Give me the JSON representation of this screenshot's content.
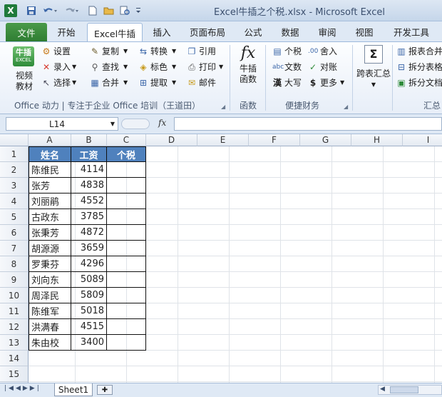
{
  "window": {
    "title": "Excel牛插之个税.xlsx - Microsoft Excel",
    "app_icon": "X"
  },
  "quick_access": {
    "save_icon": "save-icon",
    "undo_icon": "undo-icon",
    "redo_icon": "redo-icon",
    "new_icon": "new-file-icon",
    "open_icon": "open-folder-icon",
    "preview_icon": "print-preview-icon",
    "customize_icon": "customize-icon"
  },
  "tabs": [
    {
      "label": "文件"
    },
    {
      "label": "开始"
    },
    {
      "label": "Excel牛插"
    },
    {
      "label": "插入"
    },
    {
      "label": "页面布局"
    },
    {
      "label": "公式"
    },
    {
      "label": "数据"
    },
    {
      "label": "审阅"
    },
    {
      "label": "视图"
    },
    {
      "label": "开发工具"
    }
  ],
  "ribbon": {
    "logo": {
      "line1": "牛插",
      "line2": "EXCEL"
    },
    "video": {
      "line1": "视频",
      "line2": "教材"
    },
    "g1": {
      "settings": "设置",
      "enter": "录入",
      "select": "选择"
    },
    "g2": {
      "copy": "复制",
      "find": "查找",
      "merge": "合并"
    },
    "g3": {
      "convert": "转换",
      "color": "标色",
      "extract": "提取"
    },
    "g4": {
      "quote": "引用",
      "print": "打印",
      "mail": "邮件"
    },
    "group_label_main": "Office 动力 | 专注于企业 Office 培训（王道田）",
    "fx": {
      "symbol": "fx",
      "line1": "牛插",
      "line2": "函数"
    },
    "group_label_fx": "函数",
    "tax": {
      "personal": "个税",
      "round": "舍入",
      "text": "文数",
      "check": "对账",
      "capital": "大写",
      "more": "更多"
    },
    "group_label_tax": "便捷财务",
    "summary": {
      "symbol": "Σ",
      "label": "跨表汇总"
    },
    "split": {
      "merge_report": "报表合并",
      "split_table": "拆分表格",
      "split_doc": "拆分文档"
    },
    "group_label_summary": "汇总"
  },
  "formula_bar": {
    "name_box": "L14",
    "fx_label": "fx",
    "formula": ""
  },
  "columns": [
    "A",
    "B",
    "C",
    "D",
    "E",
    "F",
    "G",
    "H",
    "I"
  ],
  "rows": [
    "1",
    "2",
    "3",
    "4",
    "5",
    "6",
    "7",
    "8",
    "9",
    "10",
    "11",
    "12",
    "13",
    "14",
    "15",
    "16"
  ],
  "table": {
    "headers": [
      "姓名",
      "工资",
      "个税"
    ],
    "data": [
      [
        "陈维民",
        "4114",
        ""
      ],
      [
        "张芳",
        "4838",
        ""
      ],
      [
        "刘丽鹃",
        "4552",
        ""
      ],
      [
        "古政东",
        "3785",
        ""
      ],
      [
        "张秉芳",
        "4872",
        ""
      ],
      [
        "胡源源",
        "3659",
        ""
      ],
      [
        "罗秉芬",
        "4296",
        ""
      ],
      [
        "刘向东",
        "5089",
        ""
      ],
      [
        "周泽民",
        "5809",
        ""
      ],
      [
        "陈维军",
        "5018",
        ""
      ],
      [
        "洪满春",
        "4515",
        ""
      ],
      [
        "朱由校",
        "3400",
        ""
      ]
    ]
  },
  "sheet_tabs": [
    {
      "label": "Sheet1"
    }
  ]
}
